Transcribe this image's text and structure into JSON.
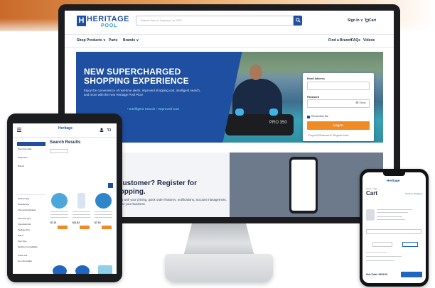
{
  "desktop": {
    "search_placeholder": "Search Item #, Keyword, or UPC",
    "signin_label": "Sign In ∨",
    "cart_label": "Cart",
    "nav": [
      "Shop Products ∨",
      "Parts",
      "Brands ∨",
      "Find a Branch",
      "FAQs",
      "Videos"
    ],
    "hero": {
      "title": "NEW SUPERCHARGED SHOPPING EXPERIENCE",
      "body": "Enjoy the convenience of real-time alerts, improved shopping cart, intelligent search, and more with the new Heritage Pool Plus!",
      "link": "• Intelligent Search • Improved Cart",
      "product_label": "PRO 350"
    },
    "login": {
      "email_label": "Email Address",
      "password_label": "Password",
      "show_label": "👁 Show",
      "remember_label": "Remember Me",
      "button_label": "Log In",
      "forgot_label": "Forgot ID/Password?   Register Now"
    },
    "lower": {
      "title": "a Customer? Register for shopping.",
      "body": "ordering with your pricing, quick order features, notifications, account management, and more your business"
    }
  },
  "logo": {
    "mark": "H",
    "word": "HERITAGE",
    "sub": "POOL"
  },
  "tablet": {
    "logo": "Heritage",
    "title": "Search Results",
    "sidebar_items": [
      "Pool Chemicals",
      "Equipment",
      "Brands",
      "",
      "",
      "",
      "Product Type",
      "Manufacturer",
      "Chemical Application",
      "Chemical Type",
      "Chemical Form",
      "Package Size",
      "Brand",
      "Pool Type",
      "Sanitizer Compatibility",
      "Check Out",
      "Item Information"
    ],
    "prices": [
      "$7.21",
      "$11.62",
      "$7.19"
    ]
  },
  "phone": {
    "logo": "Heritage",
    "crumb": "Home > Cart",
    "title": "Cart",
    "continue": "Continue Shopping",
    "total_label": "Sub-Total: $154.80"
  },
  "colors": {
    "brand_blue": "#1f4fa0",
    "accent_orange": "#f08a24",
    "link_blue": "#1f66c1"
  }
}
